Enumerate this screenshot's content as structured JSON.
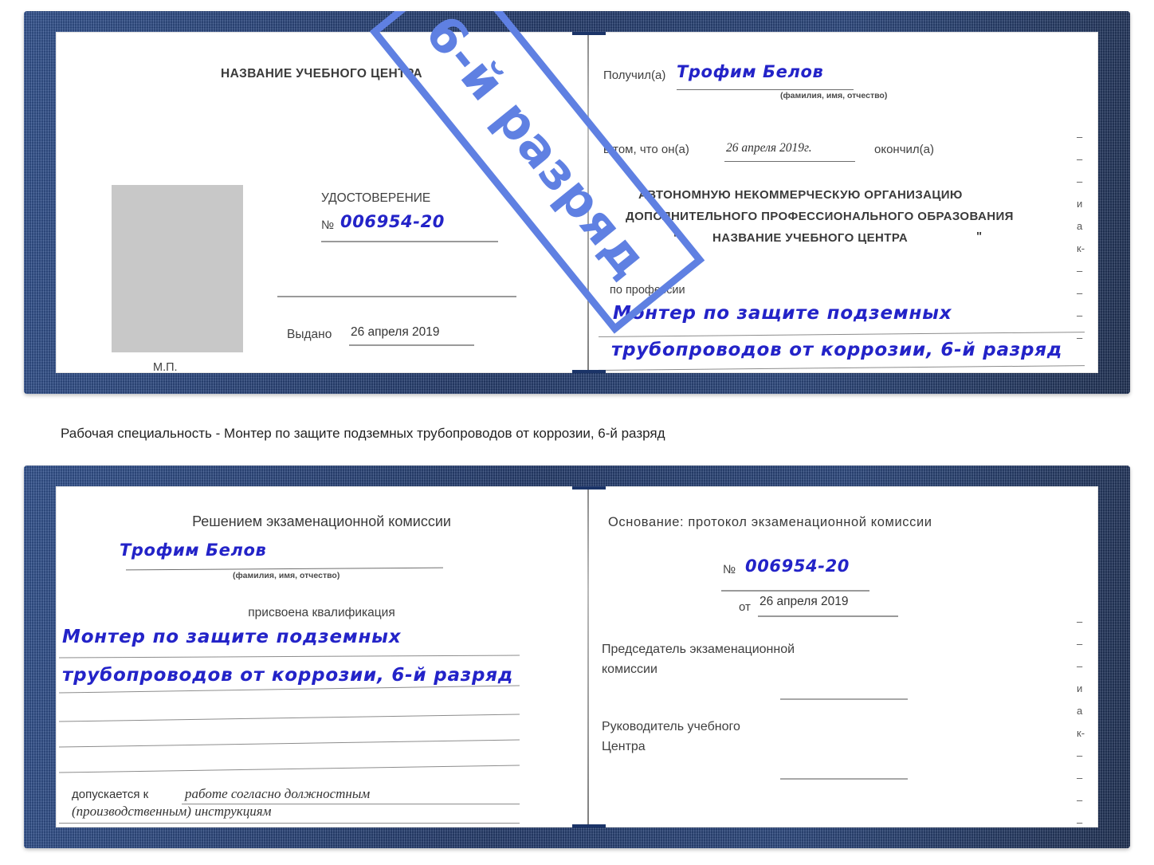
{
  "caption": "Рабочая специальность - Монтер по защите подземных трубопроводов от коррозии, 6-й разряд",
  "watermark": {
    "text": "6-й разряд",
    "color": "#5f80e2"
  },
  "colors": {
    "cover": "#21407c",
    "ink": "#2323c8",
    "rule": "#9a9a9a",
    "photo_placeholder": "#c8c8c8"
  },
  "certificate_top": {
    "left_page": {
      "header": "НАЗВАНИЕ УЧЕБНОГО ЦЕНТРА",
      "doc_title": "УДОСТОВЕРЕНИЕ",
      "number_label": "№",
      "number_value": "006954-20",
      "issued_label": "Выдано",
      "issued_value": "26 апреля 2019",
      "seal_label": "М.П."
    },
    "right_page": {
      "received_label": "Получил(а)",
      "received_value": "Трофим Белов",
      "fio_hint": "(фамилия, имя, отчество)",
      "in_that_label": "в том, что он(а)",
      "in_that_value": "26 апреля 2019г.",
      "finished_label": "окончил(а)",
      "org_line1": "АВТОНОМНУЮ НЕКОММЕРЧЕСКУЮ ОРГАНИЗАЦИЮ",
      "org_line2": "ДОПОЛНИТЕЛЬНОГО ПРОФЕССИОНАЛЬНОГО ОБРАЗОВАНИЯ",
      "org_quote_open": "\"",
      "org_line3": "НАЗВАНИЕ УЧЕБНОГО ЦЕНТРА",
      "org_quote_close": "\"",
      "profession_label": "по профессии",
      "profession_line1": "Монтер по защите подземных",
      "profession_line2": "трубопроводов от коррозии, 6-й разряд",
      "edge_fragments": [
        "–",
        "–",
        "–",
        "и",
        "а",
        "к-",
        "–",
        "–",
        "–",
        "–"
      ]
    }
  },
  "certificate_bottom": {
    "left_page": {
      "header": "Решением экзаменационной комиссии",
      "name_value": "Трофим Белов",
      "fio_hint": "(фамилия, имя, отчество)",
      "qualification_label": "присвоена квалификация",
      "qualification_line1": "Монтер по защите подземных",
      "qualification_line2": "трубопроводов от коррозии, 6-й разряд",
      "admitted_label": "допускается к",
      "admitted_value1": "работе согласно должностным",
      "admitted_value2": "(производственным) инструкциям"
    },
    "right_page": {
      "basis_label": "Основание: протокол экзаменационной комиссии",
      "number_label": "№",
      "number_value": "006954-20",
      "date_label": "от",
      "date_value": "26 апреля 2019",
      "chairman_line1": "Председатель экзаменационной",
      "chairman_line2": "комиссии",
      "head_line1": "Руководитель учебного",
      "head_line2": "Центра",
      "edge_fragments": [
        "–",
        "–",
        "–",
        "и",
        "а",
        "к-",
        "–",
        "–",
        "–",
        "–"
      ]
    }
  }
}
